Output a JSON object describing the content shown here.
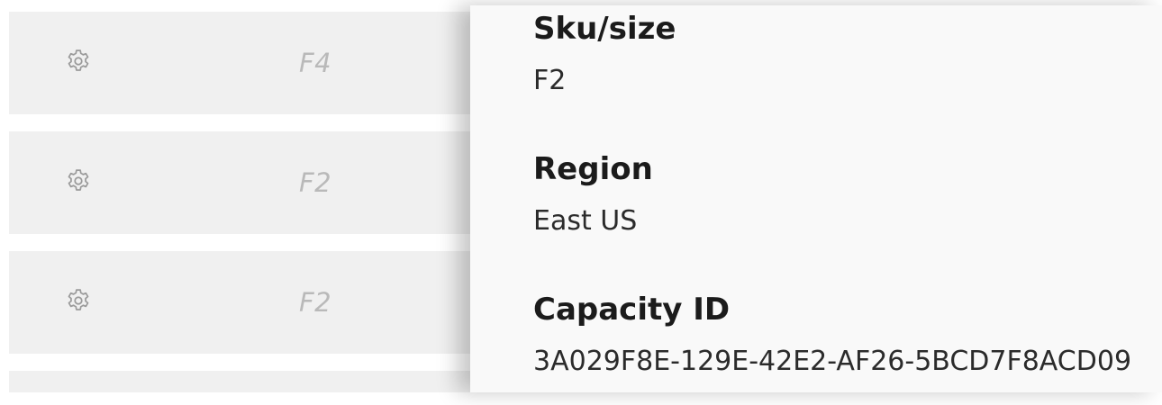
{
  "list": {
    "rows": [
      {
        "icon": "gear-icon",
        "sku": "F4"
      },
      {
        "icon": "gear-icon",
        "sku": "F2"
      },
      {
        "icon": "gear-icon",
        "sku": "F2"
      }
    ]
  },
  "details": {
    "sku_label": "Sku/size",
    "sku_value": "F2",
    "region_label": "Region",
    "region_value": "East US",
    "capacity_label": "Capacity ID",
    "capacity_value": "3A029F8E-129E-42E2-AF26-5BCD7F8ACD09"
  },
  "colors": {
    "row_bg": "#f0f0f0",
    "panel_bg": "#f9f9f9",
    "dim_text": "#b9b9b9"
  }
}
